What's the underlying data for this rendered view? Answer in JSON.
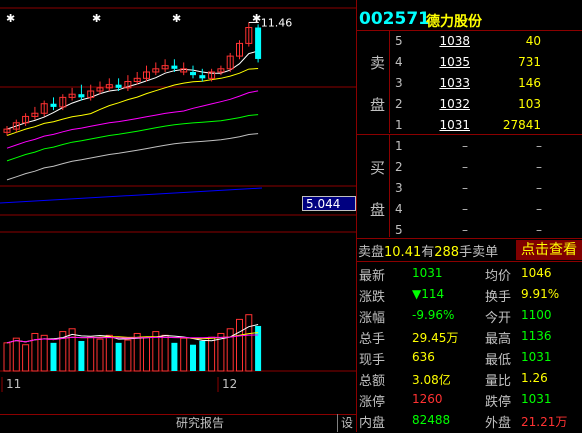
{
  "stock": {
    "code": "002571",
    "name": "德力股份"
  },
  "chart": {
    "high_label": "11.46",
    "ma_value": "5.044",
    "months": [
      "11",
      "12"
    ],
    "candles": [
      {
        "o": 8.0,
        "c": 8.1,
        "h": 8.2,
        "l": 7.9,
        "up": true
      },
      {
        "o": 8.1,
        "c": 8.3,
        "h": 8.4,
        "l": 8.0,
        "up": true
      },
      {
        "o": 8.3,
        "c": 8.5,
        "h": 8.6,
        "l": 8.2,
        "up": true
      },
      {
        "o": 8.5,
        "c": 8.6,
        "h": 8.8,
        "l": 8.4,
        "up": true
      },
      {
        "o": 8.6,
        "c": 8.9,
        "h": 9.0,
        "l": 8.5,
        "up": true
      },
      {
        "o": 8.9,
        "c": 8.8,
        "h": 9.1,
        "l": 8.7,
        "up": false
      },
      {
        "o": 8.8,
        "c": 9.1,
        "h": 9.2,
        "l": 8.7,
        "up": true
      },
      {
        "o": 9.1,
        "c": 9.2,
        "h": 9.4,
        "l": 9.0,
        "up": true
      },
      {
        "o": 9.2,
        "c": 9.1,
        "h": 9.5,
        "l": 9.0,
        "up": false
      },
      {
        "o": 9.1,
        "c": 9.3,
        "h": 9.5,
        "l": 9.0,
        "up": true
      },
      {
        "o": 9.3,
        "c": 9.4,
        "h": 9.6,
        "l": 9.2,
        "up": true
      },
      {
        "o": 9.4,
        "c": 9.5,
        "h": 9.7,
        "l": 9.3,
        "up": true
      },
      {
        "o": 9.5,
        "c": 9.4,
        "h": 9.7,
        "l": 9.3,
        "up": false
      },
      {
        "o": 9.4,
        "c": 9.6,
        "h": 9.8,
        "l": 9.3,
        "up": true
      },
      {
        "o": 9.6,
        "c": 9.7,
        "h": 9.9,
        "l": 9.5,
        "up": true
      },
      {
        "o": 9.7,
        "c": 9.9,
        "h": 10.1,
        "l": 9.6,
        "up": true
      },
      {
        "o": 9.9,
        "c": 10.0,
        "h": 10.2,
        "l": 9.8,
        "up": true
      },
      {
        "o": 10.0,
        "c": 10.1,
        "h": 10.3,
        "l": 9.9,
        "up": true
      },
      {
        "o": 10.1,
        "c": 10.0,
        "h": 10.3,
        "l": 9.9,
        "up": false
      },
      {
        "o": 10.0,
        "c": 9.9,
        "h": 10.2,
        "l": 9.8,
        "up": true
      },
      {
        "o": 9.9,
        "c": 9.8,
        "h": 10.1,
        "l": 9.7,
        "up": false
      },
      {
        "o": 9.8,
        "c": 9.7,
        "h": 10.0,
        "l": 9.6,
        "up": false
      },
      {
        "o": 9.7,
        "c": 9.9,
        "h": 10.0,
        "l": 9.6,
        "up": true
      },
      {
        "o": 9.9,
        "c": 10.0,
        "h": 10.1,
        "l": 9.8,
        "up": true
      },
      {
        "o": 10.0,
        "c": 10.4,
        "h": 10.5,
        "l": 9.9,
        "up": true
      },
      {
        "o": 10.4,
        "c": 10.8,
        "h": 10.9,
        "l": 10.3,
        "up": true
      },
      {
        "o": 10.8,
        "c": 11.3,
        "h": 11.46,
        "l": 10.7,
        "up": true
      },
      {
        "o": 11.3,
        "c": 10.31,
        "h": 11.4,
        "l": 10.2,
        "up": false
      }
    ],
    "volumes": [
      30,
      35,
      28,
      40,
      38,
      30,
      42,
      45,
      32,
      36,
      34,
      38,
      30,
      33,
      40,
      36,
      42,
      38,
      30,
      35,
      28,
      32,
      36,
      40,
      45,
      55,
      60,
      48
    ],
    "vol_up": [
      true,
      true,
      true,
      true,
      true,
      false,
      true,
      true,
      false,
      true,
      true,
      true,
      false,
      true,
      true,
      true,
      true,
      true,
      false,
      true,
      false,
      false,
      true,
      true,
      true,
      true,
      true,
      false
    ]
  },
  "orderbook": {
    "sell_label": [
      "卖",
      "盘"
    ],
    "buy_label": [
      "买",
      "盘"
    ],
    "sell": [
      {
        "level": "5",
        "price": "1038",
        "vol": "40"
      },
      {
        "level": "4",
        "price": "1035",
        "vol": "731"
      },
      {
        "level": "3",
        "price": "1033",
        "vol": "146"
      },
      {
        "level": "2",
        "price": "1032",
        "vol": "103"
      },
      {
        "level": "1",
        "price": "1031",
        "vol": "27841"
      }
    ],
    "buy": [
      {
        "level": "1",
        "price": "–",
        "vol": "–"
      },
      {
        "level": "2",
        "price": "–",
        "vol": "–"
      },
      {
        "level": "3",
        "price": "–",
        "vol": "–"
      },
      {
        "level": "4",
        "price": "–",
        "vol": "–"
      },
      {
        "level": "5",
        "price": "–",
        "vol": "–"
      }
    ]
  },
  "sell_summary": {
    "prefix": "卖盘",
    "price": "10.41",
    "mid": "有",
    "count": "288",
    "suffix": "手卖单",
    "action": "点击查看"
  },
  "stats": [
    {
      "l1": "最新",
      "v1": "1031",
      "l2": "均价",
      "v2": "1046"
    },
    {
      "l1": "涨跌",
      "v1": "▼114",
      "l2": "换手",
      "v2": "9.91%"
    },
    {
      "l1": "涨幅",
      "v1": "-9.96%",
      "l2": "今开",
      "v2": "1100"
    },
    {
      "l1": "总手",
      "v1": "29.45万",
      "l2": "最高",
      "v2": "1136"
    },
    {
      "l1": "现手",
      "v1": "636",
      "l2": "最低",
      "v2": "1031"
    },
    {
      "l1": "总额",
      "v1": "3.08亿",
      "l2": "量比",
      "v2": "1.26"
    },
    {
      "l1": "涨停",
      "v1": "1260",
      "l2": "跌停",
      "v2": "1031"
    },
    {
      "l1": "内盘",
      "v1": "82488",
      "l2": "外盘",
      "v2": "21.21万"
    }
  ],
  "bottom": {
    "report": "研究报告",
    "settings": "设"
  }
}
